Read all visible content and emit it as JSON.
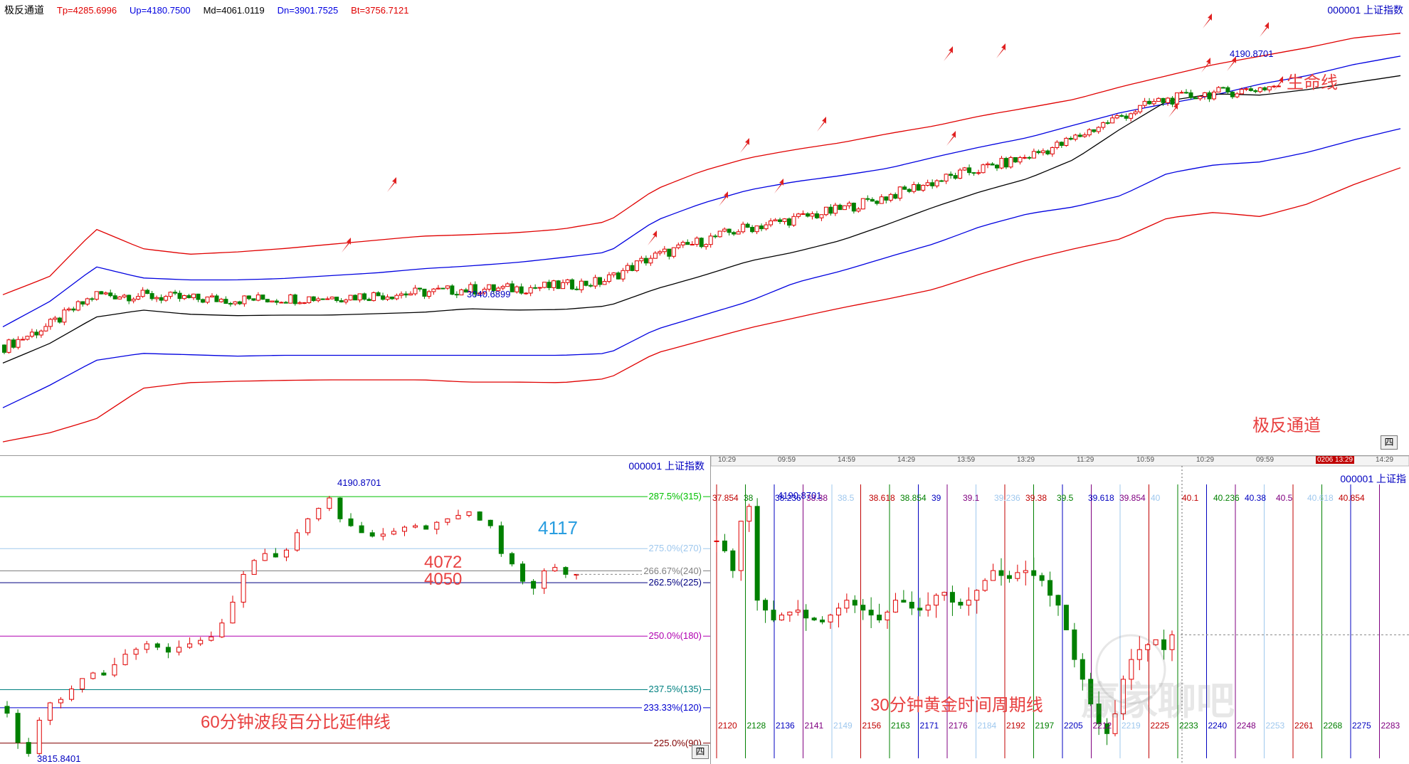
{
  "top": {
    "title": "极反通道",
    "params": [
      {
        "label": "Tp=4285.6996",
        "color": "#e00000"
      },
      {
        "label": "Up=4180.7500",
        "color": "#0000e0"
      },
      {
        "label": "Md=4061.0119",
        "color": "#000000"
      },
      {
        "label": "Dn=3901.7525",
        "color": "#0000e0"
      },
      {
        "label": "Bt=3756.7121",
        "color": "#e00000"
      }
    ],
    "symbol": "000001  上证指数",
    "label_high": "4190.8701",
    "label_low": "3040.6899",
    "annotation_lifeline": "生命线",
    "annotation_channel": "极反通道",
    "tab": "四"
  },
  "bottom_left": {
    "symbol": "000001  上证指数",
    "levels": [
      {
        "label": "287.5%(315)",
        "value": 4192,
        "color": "#00c000"
      },
      {
        "label": "275.0%(270)",
        "value": 4117,
        "color": "#9fc8ee"
      },
      {
        "label": "266.67%(240)",
        "value": 4085,
        "color": "#808080"
      },
      {
        "label": "262.5%(225)",
        "value": 4068,
        "color": "#000080"
      },
      {
        "label": "250.0%(180)",
        "value": 3991,
        "color": "#b000b0"
      },
      {
        "label": "237.5%(135)",
        "value": 3914,
        "color": "#008080"
      },
      {
        "label": "233.33%(120)",
        "value": 3888,
        "color": "#0000d0"
      },
      {
        "label": "225.0%(90)",
        "value": 3837,
        "color": "#800000"
      }
    ],
    "label_high": "4190.8701",
    "label_low": "3815.8401",
    "annotation_4117": "4117",
    "annotation_4072": "4072",
    "annotation_4050": "4050",
    "caption": "60分钟波段百分比延伸线",
    "tab": "四"
  },
  "bottom_right": {
    "time_axis": [
      "10:29",
      "09:59",
      "14:59",
      "14:29",
      "13:59",
      "13:29",
      "11:29",
      "10:59",
      "10:29",
      "09:59",
      "0206 13:29",
      "14:29"
    ],
    "symbol": "000001  上证指",
    "label_high": "4190.8701",
    "top_labels": [
      "37.854",
      "38",
      "38.236",
      "38.38",
      "38.5",
      "38.618",
      "38.854",
      "39",
      "39.1",
      "39.236",
      "39.38",
      "39.5",
      "39.618",
      "39.854",
      "40",
      "40.1",
      "40.236",
      "40.38",
      "40.5",
      "40.618",
      "40.854"
    ],
    "cycle_labels": [
      "2120",
      "2128",
      "2136",
      "2141",
      "2149",
      "2156",
      "2163",
      "2171",
      "2176",
      "2184",
      "2192",
      "2197",
      "2205",
      "2212",
      "2219",
      "2225",
      "2233",
      "2240",
      "2248",
      "2253",
      "2261",
      "2268",
      "2275",
      "2283"
    ],
    "caption": "30分钟黄金时间周期线",
    "watermark": "赢家聊吧",
    "tab": "三"
  },
  "chart_data": [
    {
      "type": "candlestick",
      "title": "极反通道",
      "series": [
        {
          "name": "Tp",
          "values": [
            3325,
            3390,
            3560,
            3490,
            3470,
            3478,
            3490,
            3505,
            3520,
            3535,
            3540,
            3547,
            3560,
            3588,
            3702,
            3768,
            3815,
            3845,
            3870,
            3902,
            3930,
            3966,
            3995,
            4025,
            4070,
            4110,
            4150,
            4180,
            4210,
            4245,
            4262
          ]
        },
        {
          "name": "Up",
          "values": [
            3210,
            3300,
            3425,
            3385,
            3378,
            3378,
            3383,
            3393,
            3403,
            3418,
            3428,
            3440,
            3458,
            3478,
            3590,
            3652,
            3700,
            3730,
            3752,
            3778,
            3818,
            3855,
            3888,
            3933,
            3978,
            4010,
            4040,
            4080,
            4110,
            4150,
            4180
          ]
        },
        {
          "name": "Md",
          "values": [
            3080,
            3150,
            3245,
            3270,
            3255,
            3250,
            3252,
            3252,
            3257,
            3262,
            3275,
            3270,
            3272,
            3285,
            3345,
            3392,
            3445,
            3478,
            3520,
            3578,
            3640,
            3695,
            3741,
            3810,
            3920,
            4020,
            4045,
            4040,
            4060,
            4085,
            4110
          ]
        },
        {
          "name": "Dn",
          "values": [
            2920,
            3000,
            3090,
            3115,
            3110,
            3105,
            3108,
            3108,
            3108,
            3108,
            3108,
            3108,
            3108,
            3115,
            3200,
            3250,
            3300,
            3368,
            3410,
            3460,
            3508,
            3570,
            3615,
            3640,
            3680,
            3760,
            3790,
            3801,
            3835,
            3880,
            3920
          ]
        },
        {
          "name": "Bt",
          "values": [
            2798,
            2830,
            2880,
            2990,
            3010,
            3015,
            3018,
            3020,
            3020,
            3020,
            3012,
            3012,
            3010,
            3025,
            3115,
            3160,
            3205,
            3242,
            3278,
            3310,
            3345,
            3400,
            3450,
            3490,
            3525,
            3600,
            3620,
            3605,
            3650,
            3720,
            3780
          ]
        }
      ],
      "high_label": 4190.8701,
      "low_label": 3040.6899
    },
    {
      "type": "candlestick",
      "title": "60分钟波段百分比延伸线",
      "ylim": [
        3810,
        4230
      ],
      "close_values": [
        3880,
        3838,
        3822,
        3870,
        3895,
        3900,
        3915,
        3930,
        3938,
        3935,
        3950,
        3965,
        3972,
        3980,
        3975,
        3968,
        3975,
        3980,
        3985,
        3990,
        4010,
        4040,
        4080,
        4100,
        4110,
        4105,
        4115,
        4140,
        4160,
        4175,
        4190,
        4160,
        4150,
        4140,
        4135,
        4138,
        4142,
        4148,
        4150,
        4145,
        4155,
        4160,
        4165,
        4170,
        4158,
        4150,
        4110,
        4095,
        4070,
        4060,
        4085,
        4090,
        4080,
        4080
      ],
      "high_label": 4190.8701,
      "low_label": 3815.8401
    },
    {
      "type": "candlestick",
      "title": "30分钟黄金时间周期线",
      "close_values": [
        4150,
        4140,
        4120,
        4170,
        4185,
        4090,
        4080,
        4070,
        4075,
        4078,
        4080,
        4072,
        4070,
        4068,
        4075,
        4082,
        4090,
        4085,
        4080,
        4075,
        4070,
        4078,
        4090,
        4088,
        4082,
        4080,
        4085,
        4095,
        4098,
        4088,
        4085,
        4090,
        4100,
        4110,
        4120,
        4115,
        4112,
        4118,
        4120,
        4115,
        4110,
        4095,
        4085,
        4060,
        4030,
        4010,
        3985,
        3965,
        3955,
        3975,
        4010,
        4030,
        4040,
        4045,
        4050,
        4040,
        4055
      ]
    }
  ]
}
